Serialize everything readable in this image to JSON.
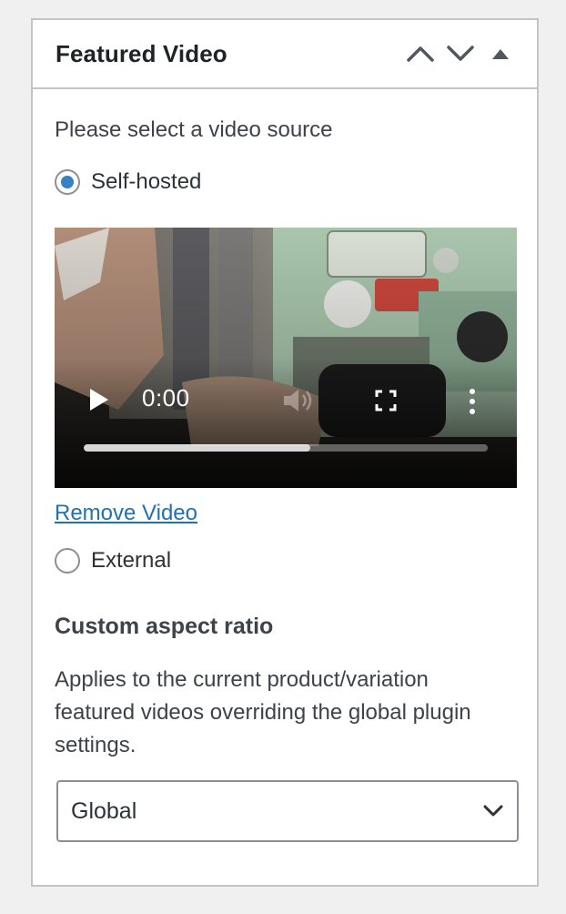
{
  "panel": {
    "title": "Featured Video",
    "icons": [
      "chevron-up-icon",
      "chevron-down-icon",
      "triangle-up-icon"
    ]
  },
  "source": {
    "prompt": "Please select a video source",
    "options": [
      {
        "label": "Self-hosted",
        "checked": true
      },
      {
        "label": "External",
        "checked": false
      }
    ]
  },
  "video": {
    "time": "0:00",
    "progress_fraction": 0.56,
    "icons": [
      "play-icon",
      "volume-icon",
      "fullscreen-icon",
      "more-vertical-icon"
    ]
  },
  "remove_link": "Remove Video",
  "aspect": {
    "heading": "Custom aspect ratio",
    "description": "Applies to the current product/variation featured videos overriding the global plugin settings.",
    "select_value": "Global"
  },
  "colors": {
    "accent": "#3582c4",
    "link": "#2271b1",
    "border": "#c3c4c7",
    "page_bg": "#f0f0f1"
  }
}
